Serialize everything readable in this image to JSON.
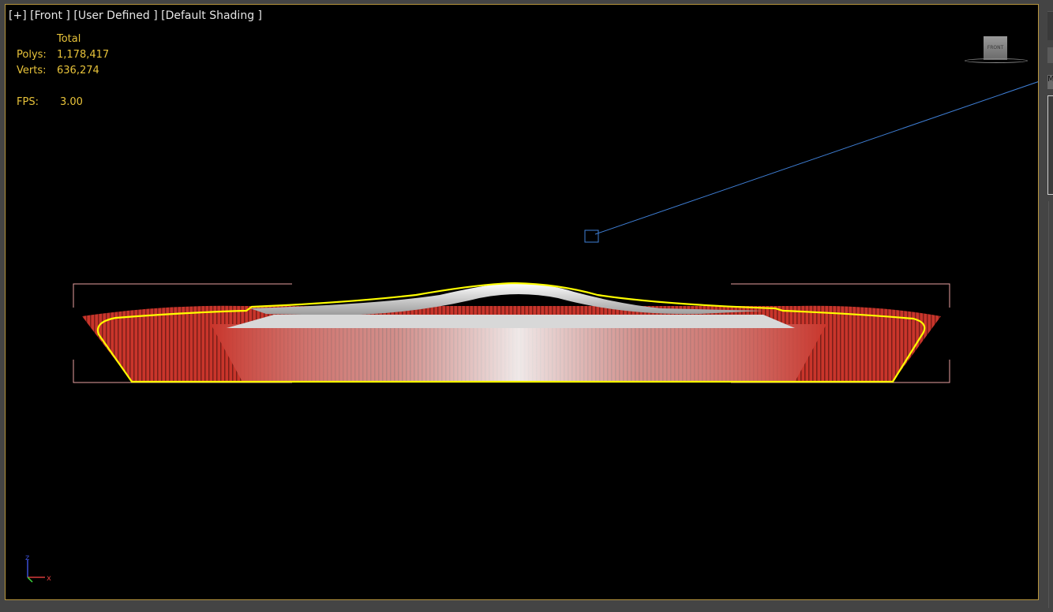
{
  "viewport": {
    "label_parts": [
      "[+]",
      "[Front ]",
      "[User Defined ]",
      "[Default Shading ]"
    ],
    "stats": {
      "header": "Total",
      "polys_label": "Polys:",
      "polys_value": "1,178,417",
      "verts_label": "Verts:",
      "verts_value": "636,274",
      "fps_label": "FPS:",
      "fps_value": "3.00"
    },
    "viewcube_face": "FRONT",
    "axis": {
      "z_label": "z",
      "x_label": "x"
    }
  },
  "right_panel": {
    "button_label": "M"
  },
  "colors": {
    "viewport_border": "#b8963e",
    "stats_text": "#e8c33a",
    "selection_outline": "#ffff00",
    "model_red": "#c9352b",
    "model_white": "#e8e8e8",
    "camera_line": "#3f7fd6",
    "bbox_bracket": "#e8a0a0"
  },
  "icons": {
    "viewcube": "viewcube-icon",
    "axis_tripod": "axis-tripod-icon",
    "camera_target": "camera-target-icon"
  }
}
